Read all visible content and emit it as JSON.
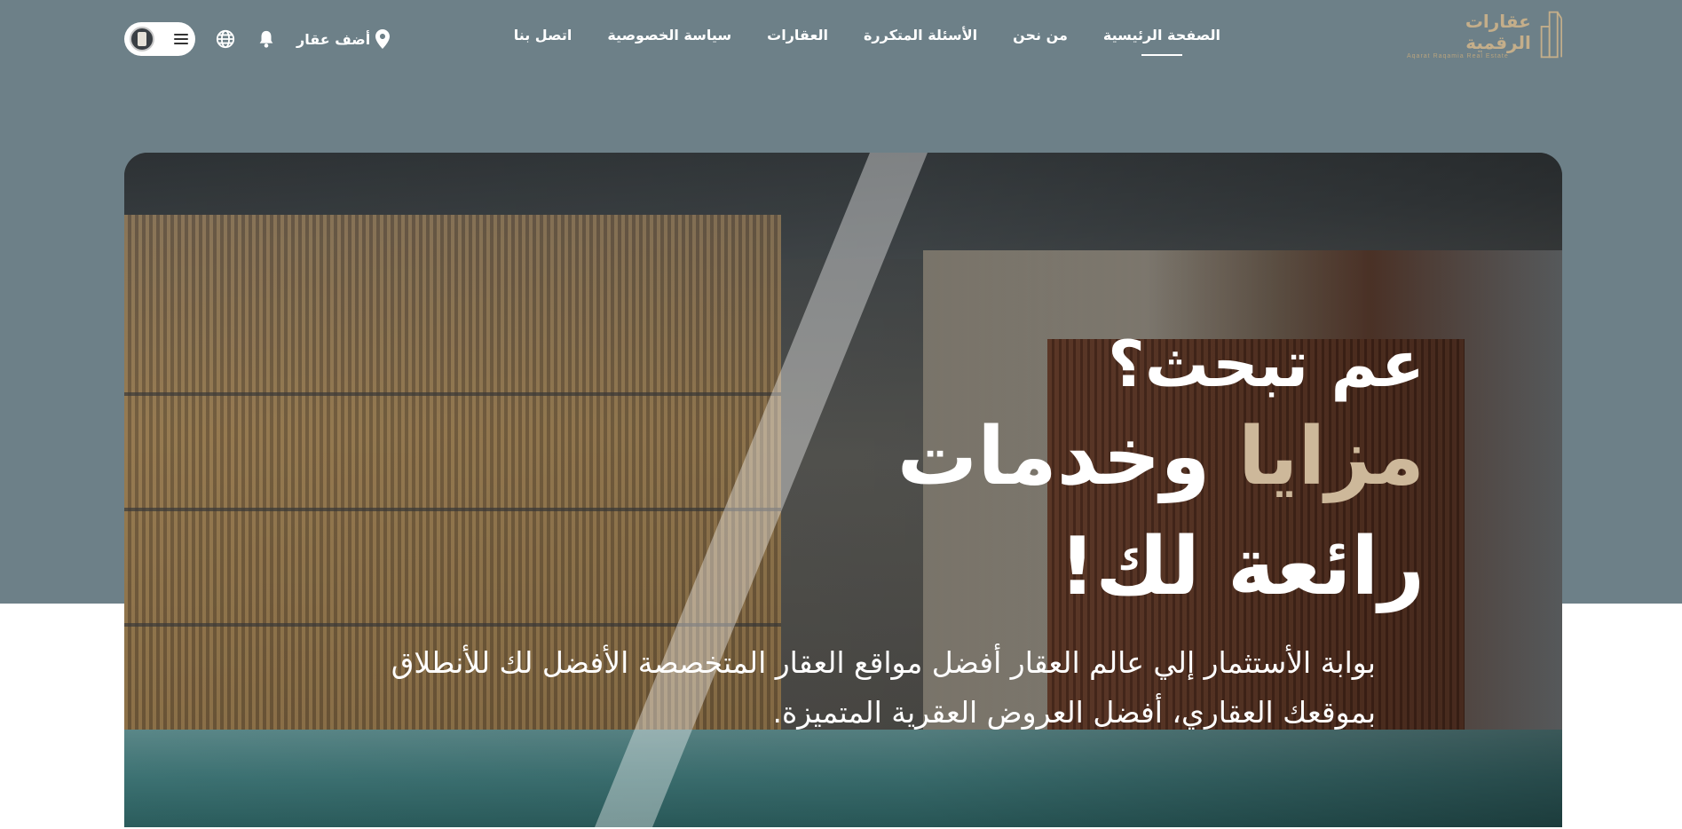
{
  "colors": {
    "band": "#6d8088",
    "accent_gold": "#c4ae8a",
    "hero_accent": "#cdb89a",
    "white": "#ffffff"
  },
  "header": {
    "logo": {
      "name": "عقارات الرقمية",
      "tagline": "Aqarat Raqamia Real Estate",
      "icon": "building-logo-icon"
    },
    "nav": [
      {
        "label": "الصفحة الرئيسية",
        "active": true
      },
      {
        "label": "من نحن"
      },
      {
        "label": "الأسئلة المتكررة"
      },
      {
        "label": "العقارات"
      },
      {
        "label": "سياسة الخصوصية"
      },
      {
        "label": "اتصل بنا"
      }
    ],
    "tools": {
      "add_property": "أضف عقار",
      "add_property_icon": "location-pin-icon",
      "notification_icon": "bell-icon",
      "language_icon": "globe-icon",
      "menu_icon": "hamburger-menu-icon",
      "avatar": "user-avatar"
    }
  },
  "hero": {
    "question": "عم تبحث؟",
    "line2_accent": "مزايا",
    "line2_rest": "وخدمات",
    "line3": "رائعة لك!",
    "description": "بوابة الأستثمار إلي عالم العقار أفضل مواقع العقار المتخصصة الأفضل لك للأنطلاق بموقعك العقاري، أفضل العروض العقرية المتميزة."
  }
}
